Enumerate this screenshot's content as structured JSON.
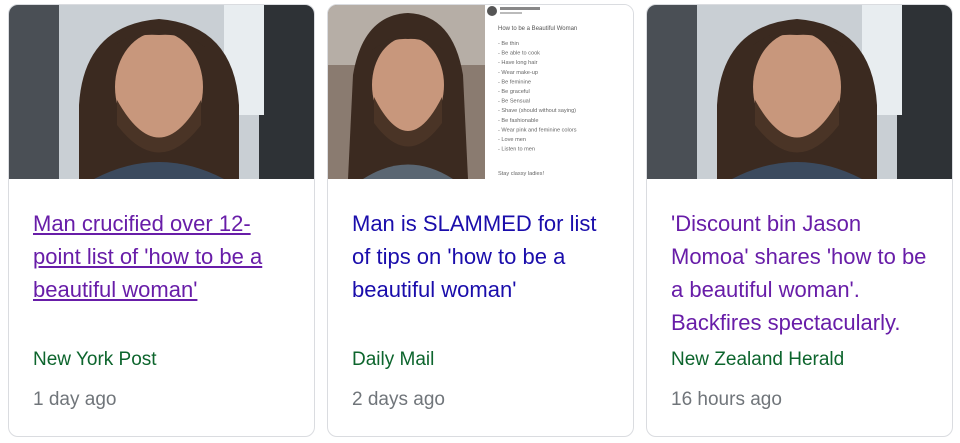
{
  "cards": [
    {
      "headline": "Man crucified over 12-point list of 'how to be a beautiful woman'",
      "source": "New York Post",
      "time": "1 day ago"
    },
    {
      "headline": "Man is SLAMMED for list of tips on 'how to be a beautiful woman'",
      "source": "Daily Mail",
      "time": "2 days ago",
      "tweet": {
        "title": "How to be a Beautiful Woman",
        "lines": [
          "- Be thin",
          "- Be able to cook",
          "- Have long hair",
          "- Wear make-up",
          "- Be feminine",
          "- Be graceful",
          "- Be Sensual",
          "- Shave (should without saying)",
          "- Be fashionable",
          "- Wear pink and feminine colors",
          "- Love men",
          "- Listen to men"
        ],
        "signoff": "Stay classy ladies!"
      }
    },
    {
      "headline": "'Discount bin Jason Momoa' shares 'how to be a beautiful woman'. Backfires spectacularly.",
      "source": "New Zealand Herald",
      "time": "16 hours ago"
    }
  ],
  "colors": {
    "visited": "#681da8",
    "link": "#1a0dab",
    "source": "#0d652d",
    "time": "#70757a"
  }
}
